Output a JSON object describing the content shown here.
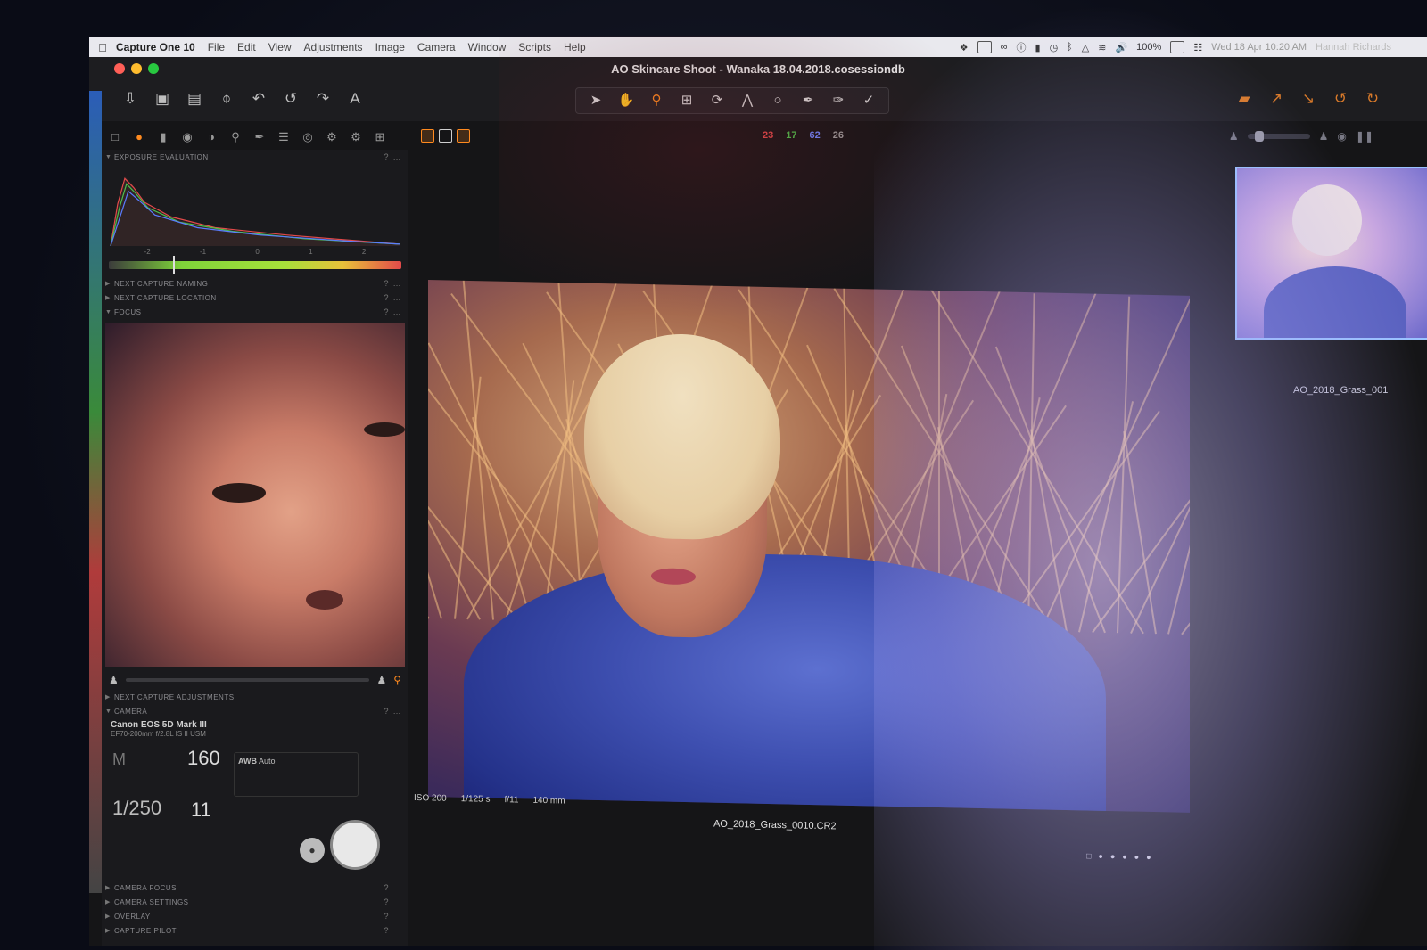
{
  "menubar": {
    "app_name": "Capture One 10",
    "items": [
      "File",
      "Edit",
      "View",
      "Adjustments",
      "Image",
      "Camera",
      "Window",
      "Scripts",
      "Help"
    ],
    "battery": "100%",
    "clock": "Wed 18 Apr 10:20 AM",
    "user": "Hannah Richards"
  },
  "window": {
    "title": "AO Skincare Shoot - Wanaka 18.04.2018.cosessiondb"
  },
  "viewer": {
    "counts": [
      "23",
      "17",
      "62",
      "26"
    ],
    "iso": "ISO 200",
    "shutter": "1/125 s",
    "aperture": "f/11",
    "focal_length": "140 mm",
    "filename": "AO_2018_Grass_0010.CR2"
  },
  "browser": {
    "thumb_label": "AO_2018_Grass_001"
  },
  "left_panel": {
    "sections": {
      "exposure": "EXPOSURE EVALUATION",
      "naming": "NEXT CAPTURE NAMING",
      "location": "NEXT CAPTURE LOCATION",
      "focus": "FOCUS",
      "next_adjust": "NEXT CAPTURE ADJUSTMENTS",
      "camera": "CAMERA",
      "camera_focus": "CAMERA FOCUS",
      "camera_settings": "CAMERA SETTINGS",
      "overlay": "OVERLAY",
      "capture_pilot": "CAPTURE PILOT"
    },
    "histogram_scale": [
      "-2",
      "-1",
      "0",
      "1",
      "2"
    ],
    "camera": {
      "model": "Canon EOS 5D Mark III",
      "lens": "EF70-200mm f/2.8L IS II USM",
      "mode": "M",
      "iso": "160",
      "shutter": "1/250",
      "aperture": "11",
      "wb_label": "AWB",
      "wb_sub": "Auto"
    }
  },
  "colors": {
    "accent": "#ff8a1f",
    "count_red": "#e24a4a",
    "count_green": "#4cc04c",
    "count_blue": "#6e86ff",
    "count_gray": "#9a9a9a"
  }
}
